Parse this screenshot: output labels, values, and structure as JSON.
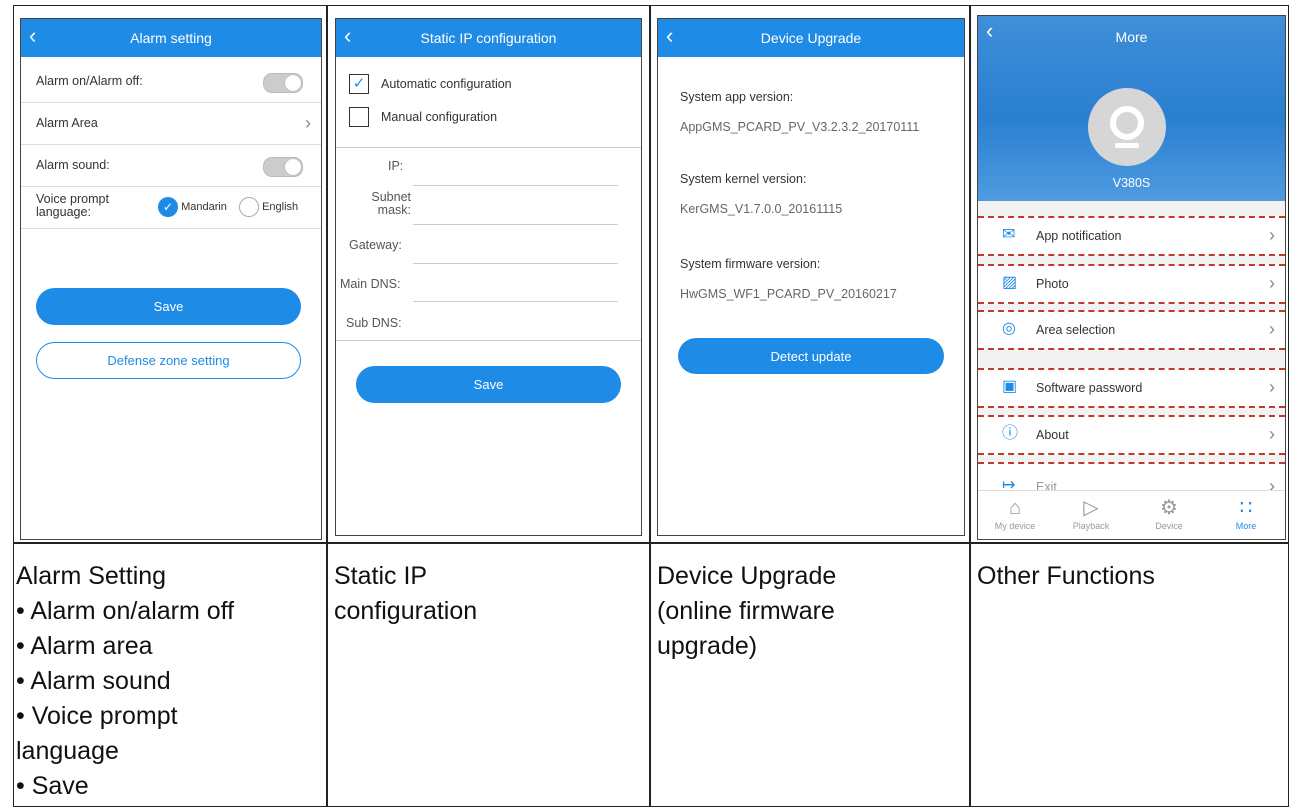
{
  "panels": {
    "alarm": {
      "title": "Alarm setting",
      "rows": {
        "alarm_onoff": "Alarm on/Alarm off:",
        "alarm_area": "Alarm Area",
        "alarm_sound": "Alarm sound:",
        "voice_prompt_1": "Voice prompt",
        "voice_prompt_2": "language:",
        "lang_mandarin": "Mandarin",
        "lang_english": "English"
      },
      "save_label": "Save",
      "defense_label": "Defense zone setting"
    },
    "static_ip": {
      "title": "Static IP configuration",
      "auto_label": "Automatic configuration",
      "manual_label": "Manual configuration",
      "fields": {
        "ip": "IP:",
        "subnet_1": "Subnet",
        "subnet_2": "mask:",
        "gateway": "Gateway:",
        "main_dns": "Main DNS:",
        "sub_dns": "Sub DNS:"
      },
      "save_label": "Save"
    },
    "upgrade": {
      "title": "Device Upgrade",
      "app_version_label": "System app version:",
      "app_version_value": "AppGMS_PCARD_PV_V3.2.3.2_20170111",
      "kernel_version_label": "System kernel version:",
      "kernel_version_value": "KerGMS_V1.7.0.0_20161115",
      "firmware_version_label": "System firmware version:",
      "firmware_version_value": "HwGMS_WF1_PCARD_PV_20160217",
      "detect_label": "Detect update"
    },
    "more": {
      "title": "More",
      "device_name": "V380S",
      "items": {
        "app_notification": "App notification",
        "photo": "Photo",
        "area_selection": "Area selection",
        "software_password": "Software password",
        "about": "About",
        "exit": "Exit"
      },
      "tabs": {
        "my_device": "My device",
        "playback": "Playback",
        "device": "Device",
        "more": "More"
      }
    }
  },
  "captions": {
    "alarm": {
      "title": "Alarm Setting",
      "bullets": [
        "• Alarm on/alarm off",
        "• Alarm area",
        "• Alarm sound",
        "• Voice prompt",
        "language",
        "• Save"
      ]
    },
    "static_ip": {
      "line1": "Static IP",
      "line2": "configuration"
    },
    "upgrade": {
      "line1": "Device Upgrade",
      "line2": "(online firmware",
      "line3": "upgrade)"
    },
    "more": {
      "line1": "Other Functions"
    }
  },
  "colors": {
    "accent": "#1e8be6",
    "dash": "#c0392b"
  }
}
